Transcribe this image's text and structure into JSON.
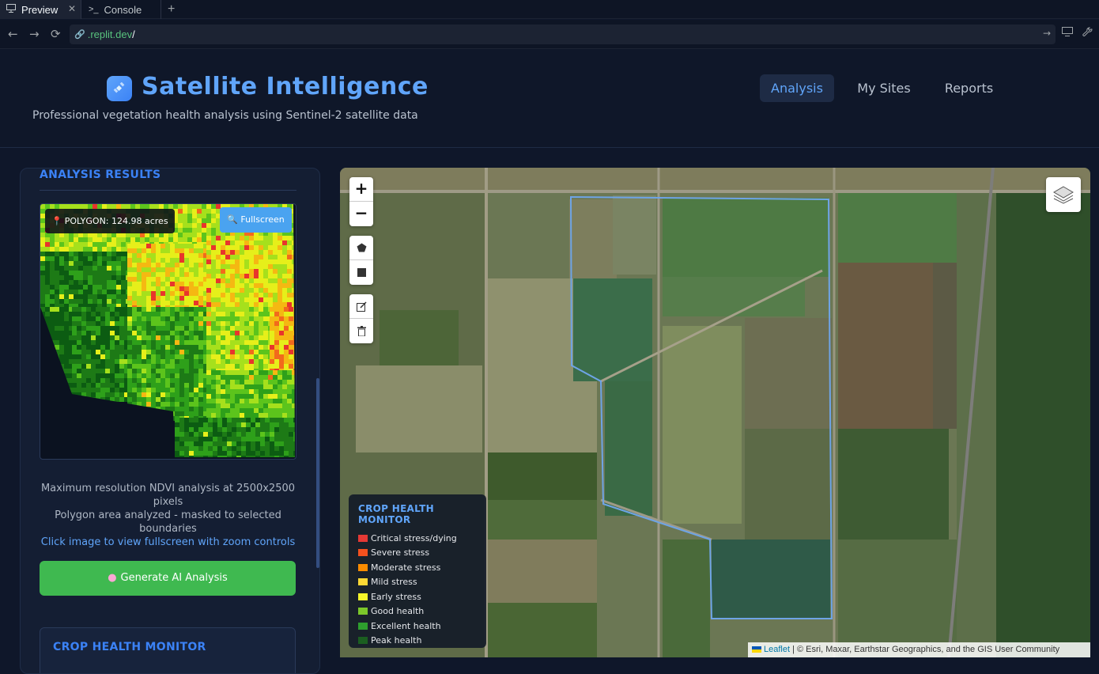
{
  "browser": {
    "tabs": [
      {
        "label": "Preview",
        "icon": "monitor-icon",
        "active": true
      },
      {
        "label": "Console",
        "icon": "terminal-icon",
        "active": false
      }
    ],
    "new_tab_label": "+",
    "url_host": ".replit.dev",
    "url_path": "/"
  },
  "header": {
    "brand_icon": "satellite-icon",
    "title": "Satellite Intelligence",
    "tagline": "Professional vegetation health analysis using Sentinel-2 satellite data",
    "nav": [
      {
        "label": "Analysis",
        "active": true
      },
      {
        "label": "My Sites",
        "active": false
      },
      {
        "label": "Reports",
        "active": false
      }
    ]
  },
  "results": {
    "title": "ANALYSIS RESULTS",
    "polygon_badge": "POLYGON: 124.98 acres",
    "fullscreen_label": "Fullscreen",
    "notes": [
      "Maximum resolution NDVI analysis at 2500x2500 pixels",
      "Polygon area analyzed - masked to selected boundaries"
    ],
    "link_text": "Click image to view fullscreen with zoom controls",
    "ai_button": "Generate AI Analysis",
    "monitor_title": "CROP HEALTH MONITOR"
  },
  "map": {
    "zoom_in": "+",
    "zoom_out": "−",
    "legend_title": "CROP HEALTH MONITOR",
    "legend": [
      {
        "label": "Critical stress/dying",
        "color": "#e53935"
      },
      {
        "label": "Severe stress",
        "color": "#f4511e"
      },
      {
        "label": "Moderate stress",
        "color": "#fb8c00"
      },
      {
        "label": "Mild stress",
        "color": "#fdd835"
      },
      {
        "label": "Early stress",
        "color": "#f5f52a"
      },
      {
        "label": "Good health",
        "color": "#7cc72a"
      },
      {
        "label": "Excellent health",
        "color": "#2e9e2e"
      },
      {
        "label": "Peak health",
        "color": "#1b5e20"
      }
    ],
    "attribution_link": "Leaflet",
    "attribution_text": "| © Esri, Maxar, Earthstar Geographics, and the GIS User Community"
  },
  "colors": {
    "accent": "#60a5fa",
    "primary_button": "#3fb950",
    "fullscreen_button": "#4aa3f0"
  }
}
